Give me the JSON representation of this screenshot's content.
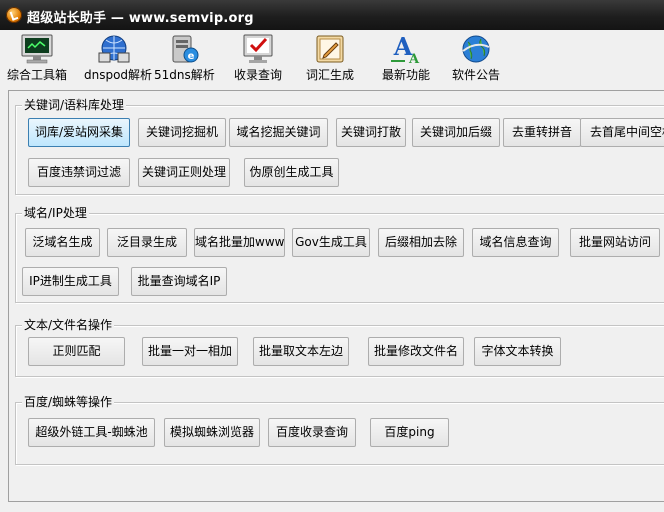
{
  "window": {
    "title": "超级站长助手 — www.semvip.org"
  },
  "toolbar": {
    "items": [
      {
        "label": "综合工具箱",
        "icon": "monitor-icon"
      },
      {
        "label": "dnspod解析",
        "icon": "network-icon"
      },
      {
        "label": "51dns解析",
        "icon": "server-ie-icon"
      },
      {
        "label": "收录查询",
        "icon": "check-monitor-icon"
      },
      {
        "label": "词汇生成",
        "icon": "edit-icon"
      },
      {
        "label": "最新功能",
        "icon": "font-icon"
      },
      {
        "label": "软件公告",
        "icon": "globe-icon"
      }
    ]
  },
  "groups": [
    {
      "title": "关键词/语料库处理",
      "buttons": [
        "词库/爱站网采集",
        "关键词挖掘机",
        "域名挖掘关键词",
        "关键词打散",
        "关键词加后缀",
        "去重转拼音",
        "去首尾中间空格",
        "百度违禁词过滤",
        "关键词正则处理",
        "伪原创生成工具"
      ]
    },
    {
      "title": "域名/IP处理",
      "buttons": [
        "泛域名生成",
        "泛目录生成",
        "域名批量加www",
        "Gov生成工具",
        "后缀相加去除",
        "域名信息查询",
        "批量网站访问",
        "IP进制生成工具",
        "批量查询域名IP"
      ]
    },
    {
      "title": "文本/文件名操作",
      "buttons": [
        "正则匹配",
        "批量一对一相加",
        "批量取文本左边",
        "批量修改文件名",
        "字体文本转换"
      ]
    },
    {
      "title": "百度/蜘蛛等操作",
      "buttons": [
        "超级外链工具-蜘蛛池",
        "模拟蜘蛛浏览器",
        "百度收录查询",
        "百度ping"
      ]
    }
  ]
}
